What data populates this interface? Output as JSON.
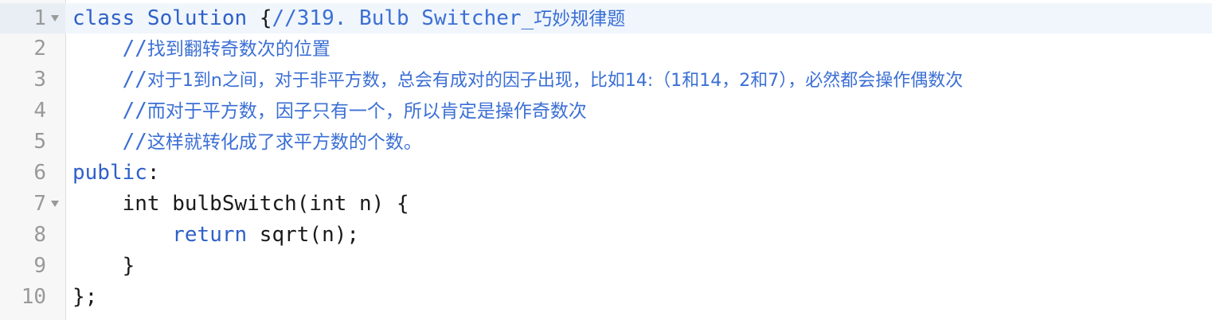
{
  "editor": {
    "lines": [
      {
        "number": "1",
        "foldable": true,
        "active": true
      },
      {
        "number": "2",
        "foldable": false
      },
      {
        "number": "3",
        "foldable": false
      },
      {
        "number": "4",
        "foldable": false
      },
      {
        "number": "5",
        "foldable": false
      },
      {
        "number": "6",
        "foldable": false
      },
      {
        "number": "7",
        "foldable": true
      },
      {
        "number": "8",
        "foldable": false
      },
      {
        "number": "9",
        "foldable": false
      },
      {
        "number": "10",
        "foldable": false
      }
    ],
    "code": {
      "l1_class": "class Solution ",
      "l1_brace": "{",
      "l1_comment_mono": "//319. Bulb Switcher_",
      "l1_comment_cjk": "巧妙规律题",
      "l2_prefix": "    //",
      "l2_text": "找到翻转奇数次的位置",
      "l3_prefix": "    //",
      "l3_text": "对于1到n之间，对于非平方数，总会有成对的因子出现，比如14:（1和14，2和7），必然都会操作偶数次",
      "l4_prefix": "    //",
      "l4_text": "而对于平方数，因子只有一个，所以肯定是操作奇数次",
      "l5_prefix": "    //",
      "l5_text": "这样就转化成了求平方数的个数。",
      "l6_kw": "public",
      "l6_rest": ":",
      "l7_text": "    int bulbSwitch(int n) {",
      "l8_indent": "        ",
      "l8_kw": "return",
      "l8_rest": " sqrt(n);",
      "l9_text": "    }",
      "l10_text": "};"
    }
  },
  "colors": {
    "keyword_blue": "#2f60c8",
    "comment_blue": "#3b6fd4",
    "text": "#1a1a1a",
    "line_number": "#999999",
    "active_line": "#f0f6fc",
    "gutter": "#f7f7f7"
  }
}
